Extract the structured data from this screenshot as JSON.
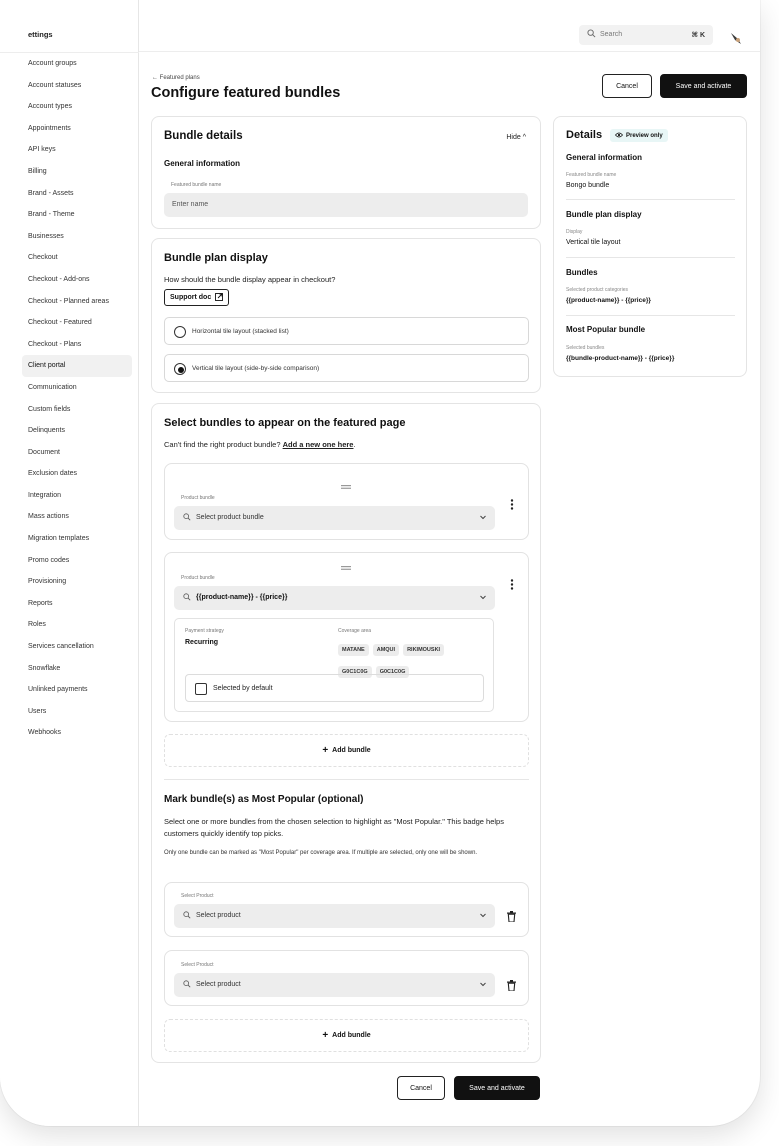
{
  "sidebar": {
    "title": "ettings",
    "items": [
      {
        "label": "Account groups",
        "active": false
      },
      {
        "label": "Account statuses",
        "active": false
      },
      {
        "label": "Account types",
        "active": false
      },
      {
        "label": "Appointments",
        "active": false
      },
      {
        "label": "API keys",
        "active": false
      },
      {
        "label": "Billing",
        "active": false
      },
      {
        "label": "Brand - Assets",
        "active": false
      },
      {
        "label": "Brand - Theme",
        "active": false
      },
      {
        "label": "Businesses",
        "active": false
      },
      {
        "label": "Checkout",
        "active": false
      },
      {
        "label": "Checkout - Add-ons",
        "active": false
      },
      {
        "label": "Checkout - Planned areas",
        "active": false
      },
      {
        "label": "Checkout - Featured",
        "active": false
      },
      {
        "label": "Checkout - Plans",
        "active": false
      },
      {
        "label": "Client portal",
        "active": true
      },
      {
        "label": "Communication",
        "active": false
      },
      {
        "label": "Custom fields",
        "active": false
      },
      {
        "label": "Delinquents",
        "active": false
      },
      {
        "label": "Document",
        "active": false
      },
      {
        "label": "Exclusion dates",
        "active": false
      },
      {
        "label": "Integration",
        "active": false
      },
      {
        "label": "Mass actions",
        "active": false
      },
      {
        "label": "Migration templates",
        "active": false
      },
      {
        "label": "Promo codes",
        "active": false
      },
      {
        "label": "Provisioning",
        "active": false
      },
      {
        "label": "Reports",
        "active": false
      },
      {
        "label": "Roles",
        "active": false
      },
      {
        "label": "Services cancellation",
        "active": false
      },
      {
        "label": "Snowflake",
        "active": false
      },
      {
        "label": "Unlinked payments",
        "active": false
      },
      {
        "label": "Users",
        "active": false
      },
      {
        "label": "Webhooks",
        "active": false
      }
    ]
  },
  "topbar": {
    "search_placeholder": "Search",
    "shortcut": "⌘ K",
    "search_icon": "search-icon"
  },
  "header": {
    "breadcrumb": "← Featured plans",
    "title": "Configure featured bundles",
    "cancel_label": "Cancel",
    "save_label": "Save and activate"
  },
  "bundle_details": {
    "title": "Bundle details",
    "hide_label": "Hide ^",
    "section": "General information",
    "name_label": "Featured bundle name",
    "name_placeholder": "Enter name"
  },
  "plan_display": {
    "title": "Bundle plan display",
    "question": "How should the bundle display appear in checkout?",
    "support_label": "Support doc",
    "options": [
      {
        "label": "Horizontal tile layout (stacked list)",
        "selected": false
      },
      {
        "label": "Vertical tile layout (side-by-side comparison)",
        "selected": true
      }
    ]
  },
  "select_bundles": {
    "title": "Select bundles to appear on the featured page",
    "help_prefix": "Can't find the right product bundle?",
    "help_link": "Add a new one here",
    "help_suffix": ".",
    "bundle1": {
      "label": "Product bundle",
      "placeholder": "Select product bundle"
    },
    "bundle2": {
      "label": "Product bundle",
      "value": "{{product-name}} - {{price}}",
      "payment_label": "Payment strategy",
      "payment_value": "Recurring",
      "coverage_label": "Coverage area",
      "tags": [
        "MATANE",
        "AMQUI",
        "RIKIMOUSKI",
        "G0C1C0G",
        "G0C1C0G"
      ],
      "default_label": "Selected by default"
    },
    "add_label": "Add bundle"
  },
  "most_popular": {
    "title": "Mark bundle(s) as Most Popular (optional)",
    "desc": "Select one or more bundles from the chosen selection to highlight as \"Most Popular.\" This badge helps customers quickly identify top picks.",
    "note": "Only one bundle can be marked as \"Most Popular\" per coverage area. If multiple are selected, only one will be shown.",
    "product_label": "Select Product",
    "product_placeholder": "Select product",
    "add_label": "Add bundle"
  },
  "footer": {
    "cancel_label": "Cancel",
    "save_label": "Save and activate"
  },
  "details_panel": {
    "title": "Details",
    "badge": "Preview only",
    "sections": [
      {
        "heading": "General information",
        "label": "Featured bundle name",
        "value": "Bongo bundle"
      },
      {
        "heading": "Bundle plan display",
        "label": "Display",
        "value": "Vertical tile layout"
      },
      {
        "heading": "Bundles",
        "label": "Selected product categories",
        "value": "{{product-name}} - {{price}}"
      },
      {
        "heading": "Most Popular bundle",
        "label": "Selected bundles",
        "value": "{{bundle-product-name}} - {{price}}"
      }
    ]
  }
}
